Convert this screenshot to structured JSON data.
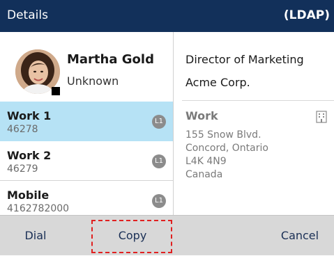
{
  "header": {
    "title": "Details",
    "directory_tag": "(LDAP)"
  },
  "contact": {
    "name": "Martha Gold",
    "status": "Unknown",
    "avatar_icon": "contact-photo",
    "presence_icon": "presence-square"
  },
  "numbers": [
    {
      "label": "Work 1",
      "value": "46278",
      "line": "L1",
      "selected": true
    },
    {
      "label": "Work 2",
      "value": "46279",
      "line": "L1",
      "selected": false
    },
    {
      "label": "Mobile",
      "value": "4162782000",
      "line": "L1",
      "selected": false
    }
  ],
  "details": {
    "job_title": "Director of Marketing",
    "company": "Acme Corp.",
    "address_label": "Work",
    "address_icon": "building-icon",
    "address_lines": [
      "155 Snow Blvd.",
      "Concord, Ontario",
      "L4K 4N9",
      "Canada"
    ]
  },
  "softkeys": {
    "dial": "Dial",
    "copy": "Copy",
    "cancel": "Cancel"
  },
  "colors": {
    "header_bg": "#12305a",
    "selected_row": "#b6e2f5",
    "highlight": "#e02020"
  }
}
